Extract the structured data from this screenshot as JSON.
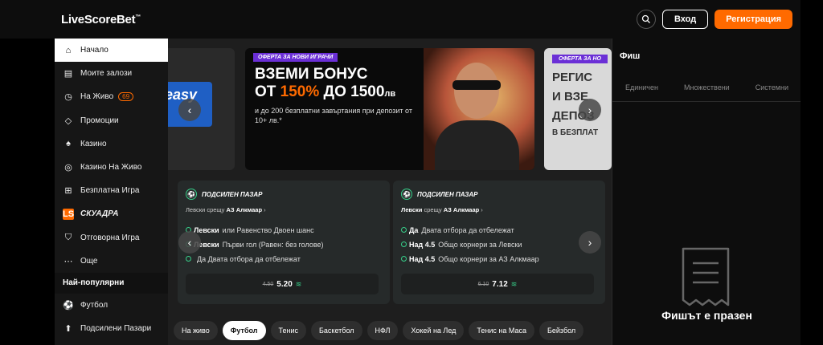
{
  "header": {
    "logo": "LiveScoreBet",
    "logo_mark": "™",
    "login": "Вход",
    "register": "Регистрация",
    "search_icon": "search-icon"
  },
  "sidebar": {
    "items": [
      {
        "label": "Начало",
        "icon": "home-icon",
        "active": true
      },
      {
        "label": "Моите залози",
        "icon": "ticket-icon"
      },
      {
        "label": "На Живо",
        "icon": "stopwatch-icon",
        "badge": "69"
      },
      {
        "label": "Промоции",
        "icon": "tag-icon"
      },
      {
        "label": "Казино",
        "icon": "cards-icon"
      },
      {
        "label": "Казино На Живо",
        "icon": "roulette-icon"
      },
      {
        "label": "Безплатна Игра",
        "icon": "cart-icon"
      },
      {
        "label": "СКУАДРА",
        "icon": "ls-icon",
        "icon_text": "LS"
      },
      {
        "label": "Отговорна Игра",
        "icon": "shield-icon"
      },
      {
        "label": "Още",
        "icon": "more-icon"
      }
    ],
    "section": "Най-популярни",
    "popular": [
      {
        "label": "Футбол",
        "icon": "football-icon"
      },
      {
        "label": "Подсилени Пазари",
        "icon": "boost-icon"
      }
    ]
  },
  "banners": {
    "left_text": "easy",
    "main": {
      "tag": "ОФЕРТА ЗА НОВИ ИГРАЧИ",
      "line1": "ВЗЕМИ БОНУС",
      "line2_a": "ОТ ",
      "line2_hl": "150%",
      "line2_b": " ДО 1500",
      "line2_unit": "лв",
      "sub": "и до 200 безплатни завъртания при депозит от 10+ лв.*"
    },
    "right": {
      "tag": "ОФЕРТА ЗА НО",
      "l1": "РЕГИС",
      "l2": "И ВЗЕ",
      "l3": "ДЕПОЗ",
      "l4": "В БЕЗПЛАТ"
    }
  },
  "markets": [
    {
      "title": "ПОДСИЛЕН ПАЗАР",
      "team1": "Левски",
      "vs": "срещу",
      "team2": "АЗ Алкмаар",
      "selections": [
        {
          "bold": "Левски",
          "text": "или Равенство Двоен шанс"
        },
        {
          "bold": "Левски",
          "text": "Първи гол (Равен: без голове)"
        },
        {
          "bold": "",
          "text": "Да Двата отбора да отбележат"
        }
      ],
      "old_odds": "4.50",
      "new_odds": "5.20"
    },
    {
      "title": "ПОДСИЛЕН ПАЗАР",
      "team1": "Левски",
      "vs": "срещу",
      "team2": "АЗ Алкмаар",
      "selections": [
        {
          "bold": "Да",
          "text": "Двата отбора да отбележат"
        },
        {
          "bold": "Над 4.5",
          "text": "Общо корнери за Левски"
        },
        {
          "bold": "Над 4.5",
          "text": "Общо корнери за АЗ Алкмаар"
        }
      ],
      "old_odds": "6.10",
      "new_odds": "7.12"
    }
  ],
  "sports": [
    "На живо",
    "Футбол",
    "Тенис",
    "Баскетбол",
    "НФЛ",
    "Хокей на Лед",
    "Тенис на Маса",
    "Бейзбол"
  ],
  "active_sport": "Футбол",
  "slip": {
    "title": "Фиш",
    "tabs": [
      "Единичен",
      "Множествени",
      "Системни"
    ],
    "empty": "Фишът е празен"
  },
  "colors": {
    "accent": "#ff6a00",
    "boost": "#37d08a",
    "tag": "#6b2fd6"
  }
}
